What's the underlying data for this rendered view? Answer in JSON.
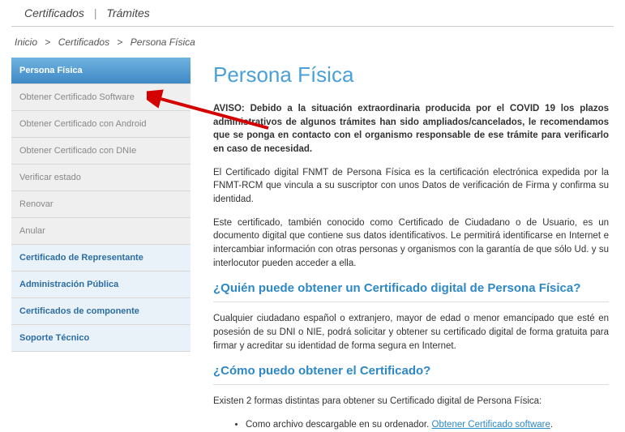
{
  "topbar": {
    "certificados": "Certificados",
    "tramites": "Trámites"
  },
  "breadcrumb": {
    "inicio": "Inicio",
    "certificados": "Certificados",
    "persona_fisica": "Persona Física"
  },
  "sidebar": {
    "header": "Persona Física",
    "items": [
      "Obtener Certificado Software",
      "Obtener Certificado con Android",
      "Obtener Certificado con DNIe",
      "Verificar estado",
      "Renovar",
      "Anular"
    ],
    "sections": [
      "Certificado de Representante",
      "Administración Pública",
      "Certificados de componente",
      "Soporte Técnico"
    ]
  },
  "content": {
    "title": "Persona Física",
    "notice": "AVISO: Debido a la situación extraordinaria producida por el COVID 19 los plazos administrativos de algunos trámites han sido ampliados/cancelados, le recomendamos que se ponga en contacto con el organismo responsable de ese trámite para verificarlo en caso de necesidad.",
    "p1": "El Certificado digital FNMT de Persona Física es la certificación electrónica expedida por la FNMT-RCM que vincula a su suscriptor con unos Datos de verificación de Firma y confirma su identidad.",
    "p2": "Este certificado, también conocido como Certificado de Ciudadano o de Usuario, es un documento digital que contiene sus datos identificativos. Le permitirá identificarse en Internet e intercambiar información con otras personas y organismos con la garantía de que sólo Ud. y su interlocutor pueden acceder a ella.",
    "h2a": "¿Quién puede obtener un Certificado digital de Persona Física?",
    "p3": "Cualquier ciudadano español o extranjero, mayor de edad o menor emancipado que esté en posesión de su DNI o NIE, podrá solicitar y obtener su certificado digital de forma gratuita para firmar y acreditar su identidad de forma segura en Internet.",
    "h2b": "¿Cómo puedo obtener el Certificado?",
    "p4": "Existen 2 formas distintas para obtener su Certificado digital de Persona Física:",
    "li1_pre": "Como archivo descargable en su ordenador. ",
    "li1_link": "Obtener Certificado software",
    "li1_post": "."
  }
}
